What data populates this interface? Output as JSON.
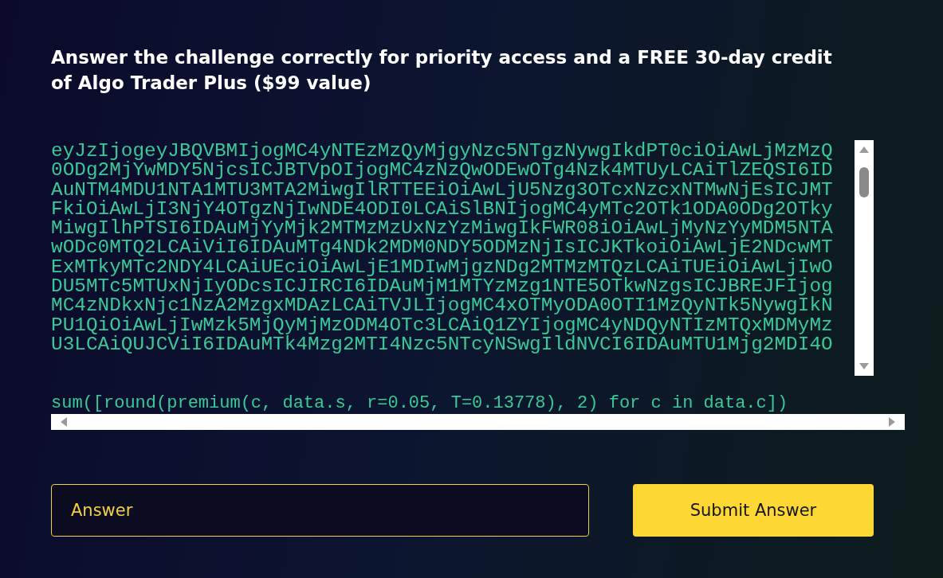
{
  "heading": "Answer the challenge correctly for priority access and a FREE 30-day credit of Algo Trader Plus ($99 value)",
  "challenge": {
    "data_lines": [
      "eyJzIjogeyJBQVBMIjogMC4yNTEzMzQyMjgyNzc5NTgzNywgIkdPT0ciOiAwLjMzMzQ",
      "0ODg2MjYwMDY5NjcsICJBTVpOIjogMC4zNzQwODEwOTg4Nzk4MTUyLCAiTlZEQSI6ID",
      "AuNTM4MDU1NTA1MTU3MTA2MiwgIlRTTEEiOiAwLjU5Nzg3OTcxNzcxNTMwNjEsICJMT",
      "FkiOiAwLjI3NjY4OTgzNjIwNDE4ODI0LCAiSlBNIjogMC4yMTc2OTk1ODA0ODg2OTky",
      "MiwgIlhPTSI6IDAuMjYyMjk2MTMzMzUxNzYzMiwgIkFWR08iOiAwLjMyNzYyMDM5NTA",
      "wODc0MTQ2LCAiViI6IDAuMTg4NDk2MDM0NDY5ODMzNjIsICJKTkoiOiAwLjE2NDcwMT",
      "ExMTkyMTc2NDY4LCAiUEciOiAwLjE1MDIwMjgzNDg2MTMzMTQzLCAiTUEiOiAwLjIwO",
      "DU5MTc5MTUxNjIyODcsICJIRCI6IDAuMjM1MTYzMzg1NTE5OTkwNzgsICJBREJFIjog",
      "MC4zNDkxNjc1NzA2MzgxMDAzLCAiTVJLIjogMC4xOTMyODA0OTI1MzQyNTk5NywgIkN",
      "PU1QiOiAwLjIwMzk5MjQyMjMzODM4OTc3LCAiQ1ZYIjogMC4yNDQyNTIzMTQxMDMyMz",
      "U3LCAiQUJCViI6IDAuMTk4Mzg2MTI4Nzc5NTcyNSwgIldNVCI6IDAuMTU1Mjg2MDI4O"
    ],
    "formula": "sum([round(premium(c, data.s, r=0.05, T=0.13778), 2) for c in data.c])"
  },
  "answer": {
    "placeholder": "Answer"
  },
  "submit": {
    "label": "Submit Answer"
  }
}
